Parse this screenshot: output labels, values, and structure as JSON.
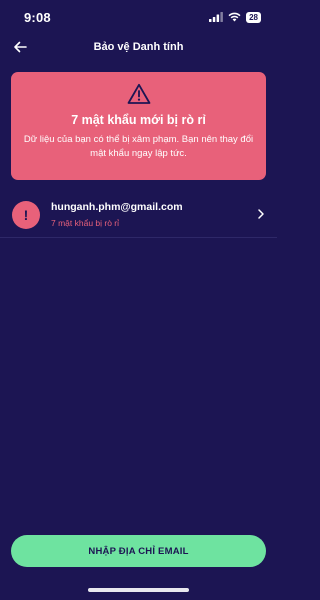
{
  "status_bar": {
    "time": "9:08",
    "battery": "28",
    "icons": [
      "cellular-icon",
      "wifi-icon",
      "battery-icon"
    ]
  },
  "header": {
    "title": "Bảo vệ Danh tính",
    "back_icon": "arrow-left-icon"
  },
  "alert": {
    "icon": "warning-triangle-icon",
    "title": "7 mật khẩu mới bị rò rỉ",
    "description": "Dữ liệu của bạn có thể bị xâm phạm. Bạn nên thay đổi mật khẩu ngay lập tức."
  },
  "accounts": [
    {
      "badge": "!",
      "email": "hunganh.phm@gmail.com",
      "subtitle": "7 mật khẩu bị rò rỉ"
    }
  ],
  "cta": {
    "label": "NHẬP ĐỊA CHỈ EMAIL"
  },
  "colors": {
    "background": "#1c1553",
    "alert": "#e8617a",
    "cta": "#6ee3a0",
    "text": "#ffffff"
  }
}
